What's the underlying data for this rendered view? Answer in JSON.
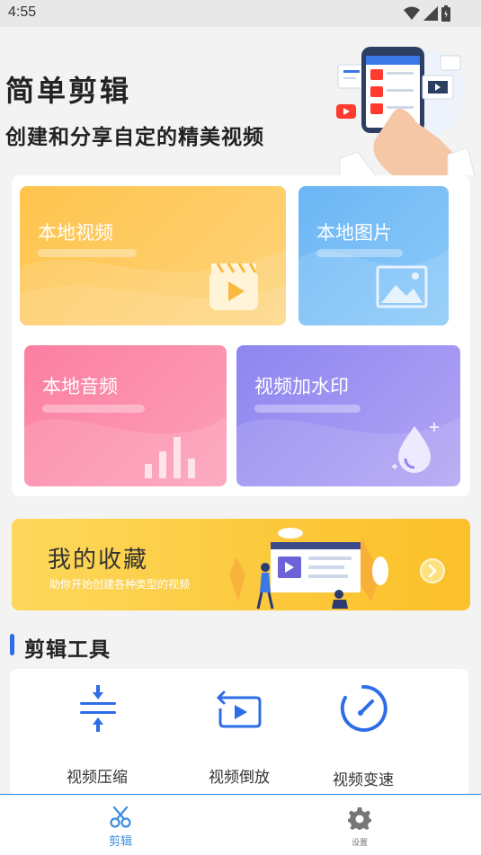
{
  "status_bar": {
    "time": "4:55"
  },
  "hero": {
    "title": "简单剪辑",
    "subtitle": "创建和分享自定的精美视频"
  },
  "cards": [
    {
      "label": "本地视频",
      "icon": "film-clapper-icon",
      "color_from": "#ffc44d",
      "color_to": "#fdd37a"
    },
    {
      "label": "本地图片",
      "icon": "image-icon",
      "color_from": "#6cb6f5",
      "color_to": "#8ccaf8"
    },
    {
      "label": "本地音频",
      "icon": "bar-chart-icon",
      "color_from": "#fc7fa2",
      "color_to": "#fca0b8"
    },
    {
      "label": "视频加水印",
      "icon": "water-drop-icon",
      "color_from": "#8e86f0",
      "color_to": "#b2a4f4"
    }
  ],
  "favorites": {
    "title": "我的收藏",
    "subtitle": "助你开始创建各种类型的视频"
  },
  "tools": {
    "heading": "剪辑工具",
    "items": [
      {
        "label": "视频压缩",
        "icon": "compress-icon"
      },
      {
        "label": "视频倒放",
        "icon": "reverse-play-icon"
      },
      {
        "label": "视频变速",
        "icon": "speedometer-icon"
      }
    ]
  },
  "nav": {
    "items": [
      {
        "label": "剪辑",
        "icon": "scissors-icon",
        "active": true
      },
      {
        "label": "设置",
        "icon": "gear-icon",
        "active": false
      }
    ]
  },
  "colors": {
    "accent": "#2f6de8",
    "nav_active": "#3a8fe0",
    "nav_inactive": "#777777"
  }
}
